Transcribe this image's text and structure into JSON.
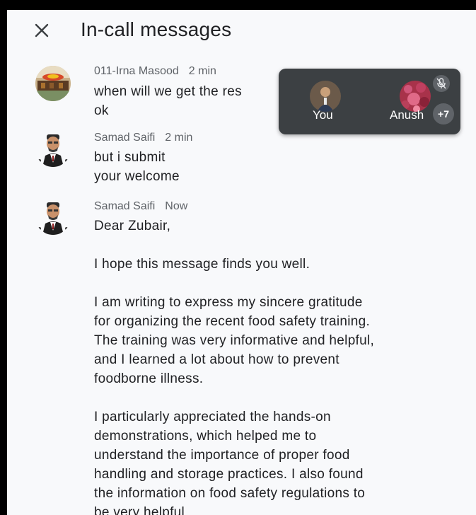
{
  "header": {
    "title": "In-call messages",
    "close_icon": "close-icon"
  },
  "messages": [
    {
      "sender": "011-Irna Masood",
      "time": "2 min",
      "lines": [
        "when will we get the res",
        "ok"
      ]
    },
    {
      "sender": "Samad Saifi",
      "time": "2 min",
      "lines": [
        "but i submit",
        "your welcome"
      ]
    },
    {
      "sender": "Samad Saifi",
      "time": "Now",
      "lines": [
        "Dear Zubair,",
        "",
        "I hope this message finds you well.",
        "",
        "I am writing to express my sincere gratitude",
        "for organizing the recent food safety training.",
        "The training was very informative and helpful,",
        "and I learned a lot about how to prevent",
        "foodborne illness.",
        "",
        "I particularly appreciated the hands-on",
        "demonstrations, which helped me to",
        "understand the importance of proper food",
        "handling and storage practices. I also found",
        "the information on food safety regulations to",
        "be very helpful"
      ]
    }
  ],
  "pip": {
    "participants": [
      {
        "name": "You"
      },
      {
        "name": "Anush"
      }
    ],
    "more_count": "+7",
    "mic_icon": "mic-off-icon"
  }
}
